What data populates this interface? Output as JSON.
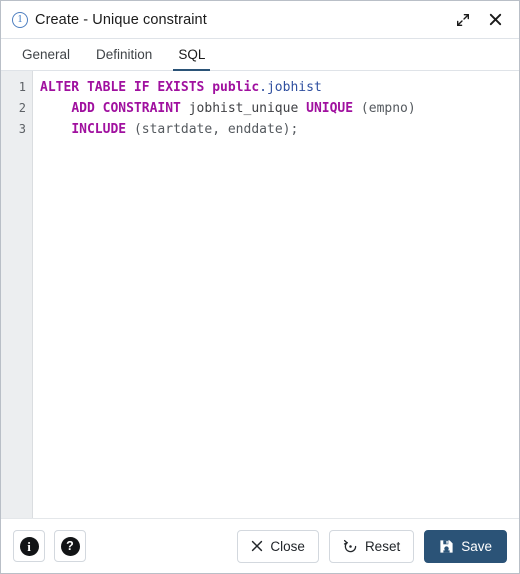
{
  "window": {
    "title": "Create - Unique constraint",
    "badge_icon": "info-number-icon",
    "badge_text": "1",
    "expand_icon": "expand-diagonal-icon",
    "close_icon": "close-icon",
    "accent_color": "#2b5377"
  },
  "tabs": [
    {
      "label": "General",
      "active": false
    },
    {
      "label": "Definition",
      "active": false
    },
    {
      "label": "SQL",
      "active": true
    }
  ],
  "editor": {
    "gutter_numbers": [
      "1",
      "2",
      "3"
    ],
    "lines": [
      {
        "number": "1",
        "text": "ALTER TABLE IF EXISTS public.jobhist",
        "tokens": [
          {
            "t": "ALTER TABLE IF EXISTS ",
            "k": "kw"
          },
          {
            "t": "public",
            "k": "kw"
          },
          {
            "t": ".jobhist",
            "k": "schema-obj"
          }
        ]
      },
      {
        "number": "2",
        "text": "    ADD CONSTRAINT jobhist_unique UNIQUE (empno)",
        "tokens": [
          {
            "t": "    ",
            "k": "punct"
          },
          {
            "t": "ADD CONSTRAINT ",
            "k": "kw"
          },
          {
            "t": "jobhist_unique ",
            "k": "ident"
          },
          {
            "t": "UNIQUE ",
            "k": "kw"
          },
          {
            "t": "(empno)",
            "k": "punct"
          }
        ]
      },
      {
        "number": "3",
        "text": "    INCLUDE (startdate, enddate);",
        "tokens": [
          {
            "t": "    ",
            "k": "punct"
          },
          {
            "t": "INCLUDE ",
            "k": "kw"
          },
          {
            "t": "(startdate, enddate);",
            "k": "punct"
          }
        ]
      }
    ],
    "keyword_color": "#a0109f",
    "object_color": "#2f4f9f",
    "text_color": "#555a5f"
  },
  "footer": {
    "info_button": {
      "name": "info-button",
      "icon": "info-icon",
      "glyph": "i"
    },
    "help_button": {
      "name": "help-button",
      "icon": "question-mark-icon",
      "glyph": "?"
    },
    "close_button": {
      "label": "Close",
      "icon": "x-icon"
    },
    "reset_button": {
      "label": "Reset",
      "icon": "reset-circular-arrow-icon"
    },
    "save_button": {
      "label": "Save",
      "icon": "floppy-disk-icon"
    }
  }
}
